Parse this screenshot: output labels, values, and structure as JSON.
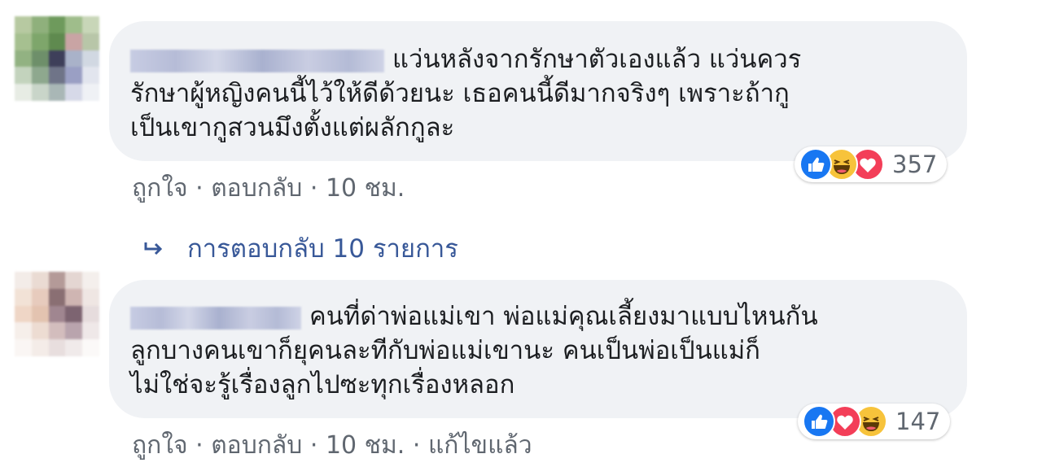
{
  "comments": [
    {
      "text_lines": [
        "แว่นหลังจากรักษาตัวเองแล้ว แว่นควร",
        "รักษาผู้หญิงคนนี้ไว้ให้ดีด้วยนะ เธอคนนี้ดีมากจริงๆ เพราะถ้ากู",
        "เป็นเขากูสวนมึงตั้งแต่ผลักกูละ"
      ],
      "actions": {
        "like": "ถูกใจ",
        "reply": "ตอบกลับ",
        "time": "10 ชม.",
        "edited": ""
      },
      "reactions": {
        "icons": [
          "like-icon",
          "haha-icon",
          "love-icon"
        ],
        "count": "357"
      },
      "avatar_colors": [
        "#b7c9a1",
        "#8fb07c",
        "#6e9a5c",
        "#9fbd8b",
        "#c8d6b8",
        "#a6c090",
        "#7ea66b",
        "#5f8a4f",
        "#c9a4a4",
        "#b8c6a8",
        "#92b282",
        "#6e8f6a",
        "#3e3f5a",
        "#a9b2c9",
        "#d1d8e2",
        "#c3d3bd",
        "#8ea88e",
        "#6f7488",
        "#9a9fc4",
        "#e2e5ee",
        "#e7ece4",
        "#c9d5c9",
        "#a9b7b6",
        "#d6d9e8",
        "#eff1f5"
      ]
    },
    {
      "text_lines": [
        "คนที่ด่าพ่อแม่เขา พ่อแม่คุณเลี้ยงมาแบบไหนกัน",
        "ลูกบางคนเขาก็ยุคนละทีกับพ่อแม่เขานะ คนเป็นพ่อเป็นแม่ก็",
        "ไม่ใช่จะรู้เรื่องลูกไปซะทุกเรื่องหลอก"
      ],
      "actions": {
        "like": "ถูกใจ",
        "reply": "ตอบกลับ",
        "time": "10 ชม.",
        "edited": "แก้ไขแล้ว"
      },
      "reactions": {
        "icons": [
          "like-icon",
          "love-icon",
          "haha-icon"
        ],
        "count": "147"
      },
      "avatar_colors": [
        "#f3ece8",
        "#eadbd3",
        "#b49a98",
        "#e4d6d2",
        "#f4efec",
        "#f2e2d6",
        "#e7cbbd",
        "#8a6f73",
        "#cfb5b2",
        "#efe6e3",
        "#efd6c6",
        "#e3c3b0",
        "#a08690",
        "#7d6471",
        "#e6dcdd",
        "#f6efea",
        "#eddcd2",
        "#d3bdbd",
        "#b9a4ad",
        "#efe8e8",
        "#faf6f4",
        "#f4ece8",
        "#e8dede",
        "#f0eaea",
        "#fbf9f8"
      ]
    }
  ],
  "replies_link": "การตอบกลับ 10 รายการ",
  "colors": {
    "link": "#385898",
    "meta": "#606770",
    "bubble": "#f0f2f5",
    "like": "#1877f2",
    "love": "#f33e58",
    "haha": "#f7c33b"
  }
}
